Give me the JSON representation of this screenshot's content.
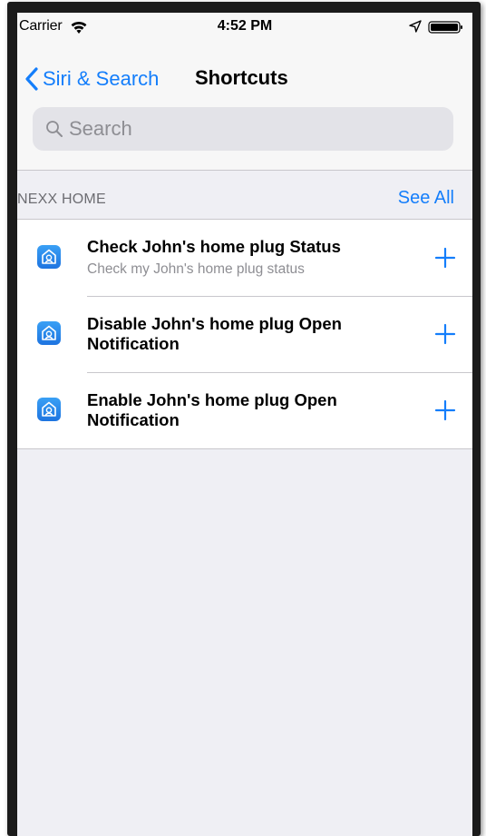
{
  "status_bar": {
    "carrier": "Carrier",
    "time": "4:52 PM",
    "icons": [
      "wifi-icon",
      "location-icon",
      "battery-icon"
    ]
  },
  "nav": {
    "back_label": "Siri & Search",
    "title": "Shortcuts"
  },
  "search": {
    "placeholder": "Search",
    "value": ""
  },
  "section": {
    "title": "NEXX HOME",
    "see_all_label": "See All"
  },
  "shortcuts": [
    {
      "title": "Check John's home plug Status",
      "subtitle": "Check my John's home plug status",
      "icon": "nexx-home-app-icon",
      "action_icon": "plus-icon"
    },
    {
      "title": "Disable John's home plug Open Notification",
      "subtitle": "",
      "icon": "nexx-home-app-icon",
      "action_icon": "plus-icon"
    },
    {
      "title": "Enable John's home plug Open Notification",
      "subtitle": "",
      "icon": "nexx-home-app-icon",
      "action_icon": "plus-icon"
    }
  ],
  "colors": {
    "accent": "#147efb",
    "background": "#efeff4",
    "secondary_text": "#8e8e93",
    "section_header_text": "#6d6d72"
  }
}
